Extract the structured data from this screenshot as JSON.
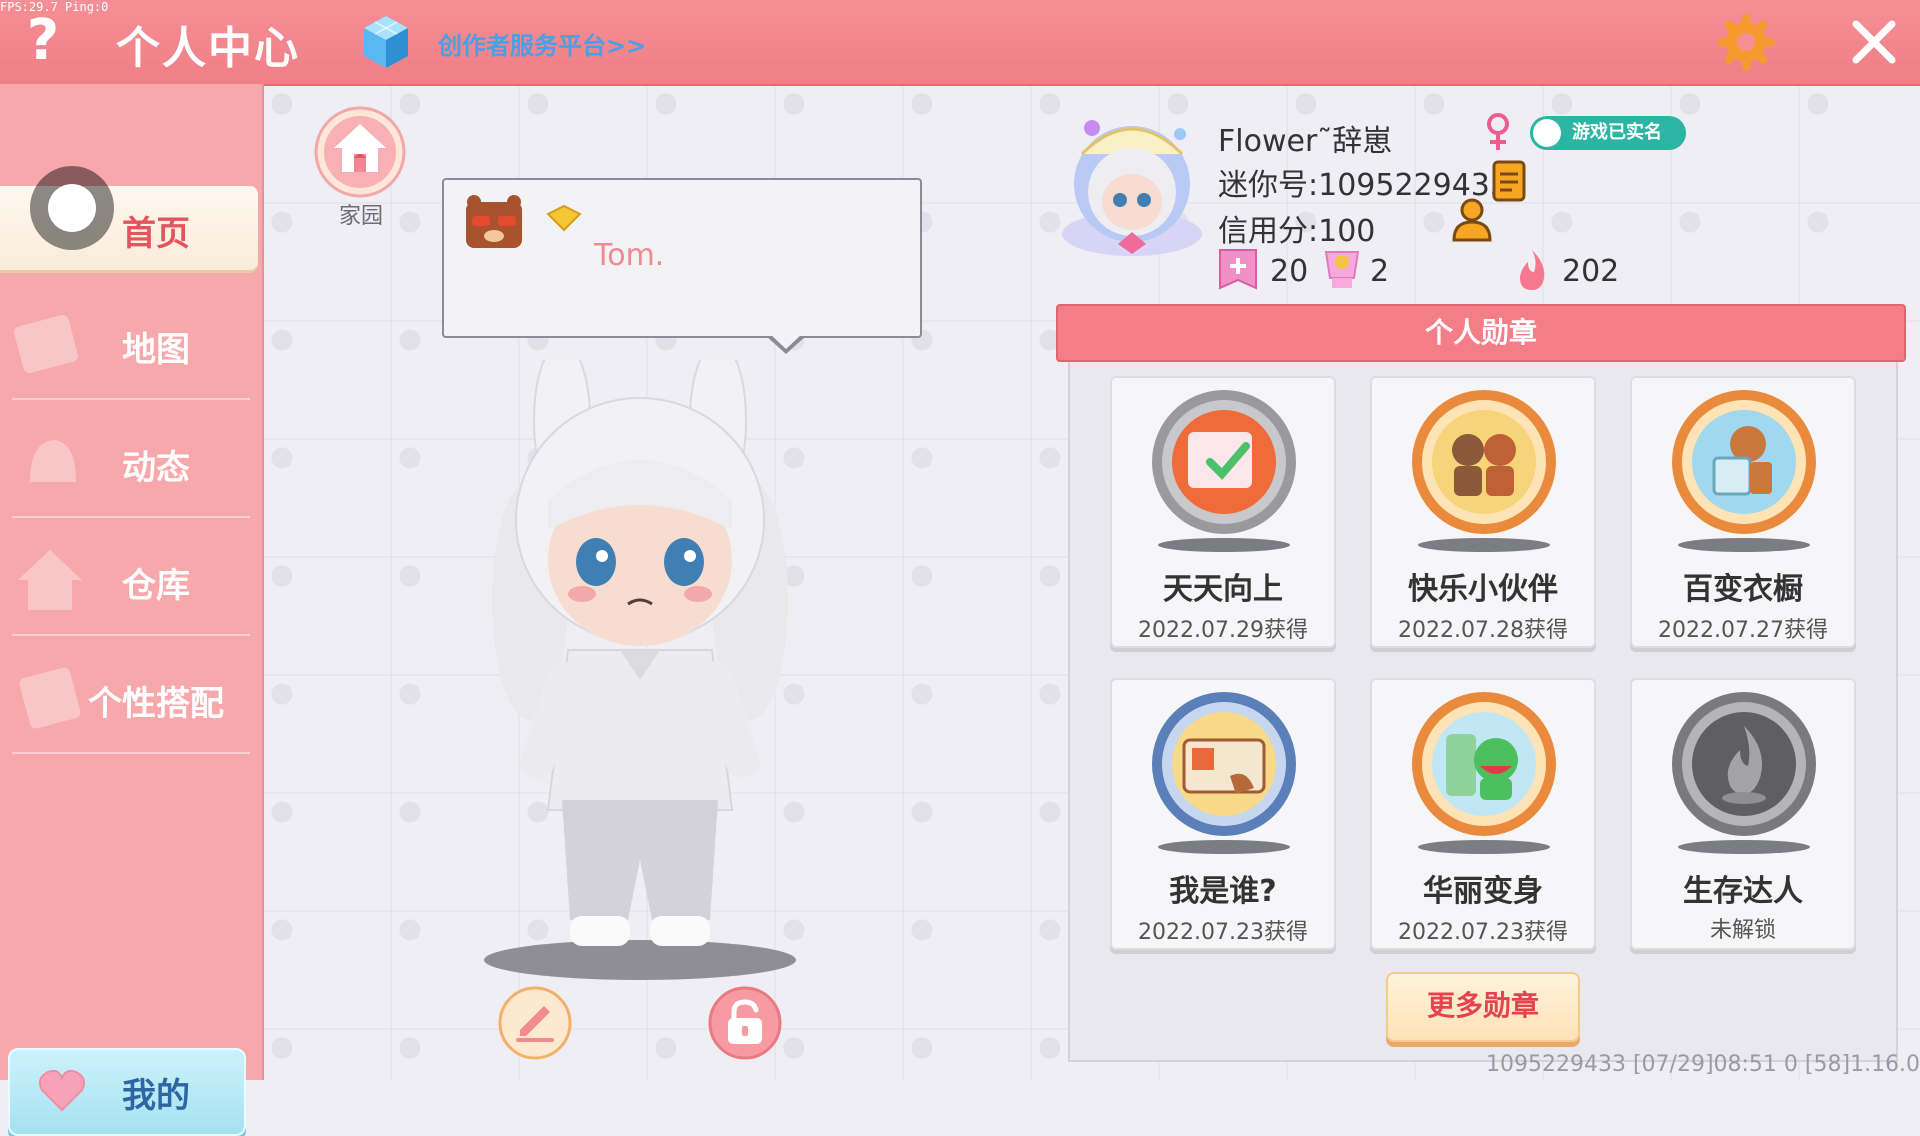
{
  "debug": {
    "fps": "FPS:29.7 Ping:0"
  },
  "header": {
    "help_icon": "question-mark-icon",
    "title": "个人中心",
    "creator_link": "创作者服务平台>>",
    "settings_icon": "gear-icon",
    "close_icon": "close-icon",
    "accent_color": "#f58f96"
  },
  "sidebar": {
    "items": [
      {
        "label": "首页",
        "active": true
      },
      {
        "label": "地图",
        "active": false
      },
      {
        "label": "动态",
        "active": false
      },
      {
        "label": "仓库",
        "active": false
      },
      {
        "label": "个性搭配",
        "active": false
      }
    ],
    "my_button": "我的"
  },
  "scene": {
    "home_label": "家园",
    "bubble_text": "Tom."
  },
  "profile": {
    "username": "Flower˜辞崽",
    "gender": "female",
    "verified": "游戏已实名",
    "mini_id": "迷你号:1095229433",
    "credit": "信用分:100",
    "stats": {
      "likes": "20",
      "fans": "2",
      "popularity": "202"
    }
  },
  "medals": {
    "header": "个人勋章",
    "items": [
      {
        "name": "天天向上",
        "status": "2022.07.29获得"
      },
      {
        "name": "快乐小伙伴",
        "status": "2022.07.28获得"
      },
      {
        "name": "百变衣橱",
        "status": "2022.07.27获得"
      },
      {
        "name": "我是谁?",
        "status": "2022.07.23获得"
      },
      {
        "name": "华丽变身",
        "status": "2022.07.23获得"
      },
      {
        "name": "生存达人",
        "status": "未解锁"
      }
    ],
    "more_button": "更多勋章"
  },
  "footer": {
    "info": "1095229433   [07/29]08:51 0   [58]1.16.0"
  }
}
